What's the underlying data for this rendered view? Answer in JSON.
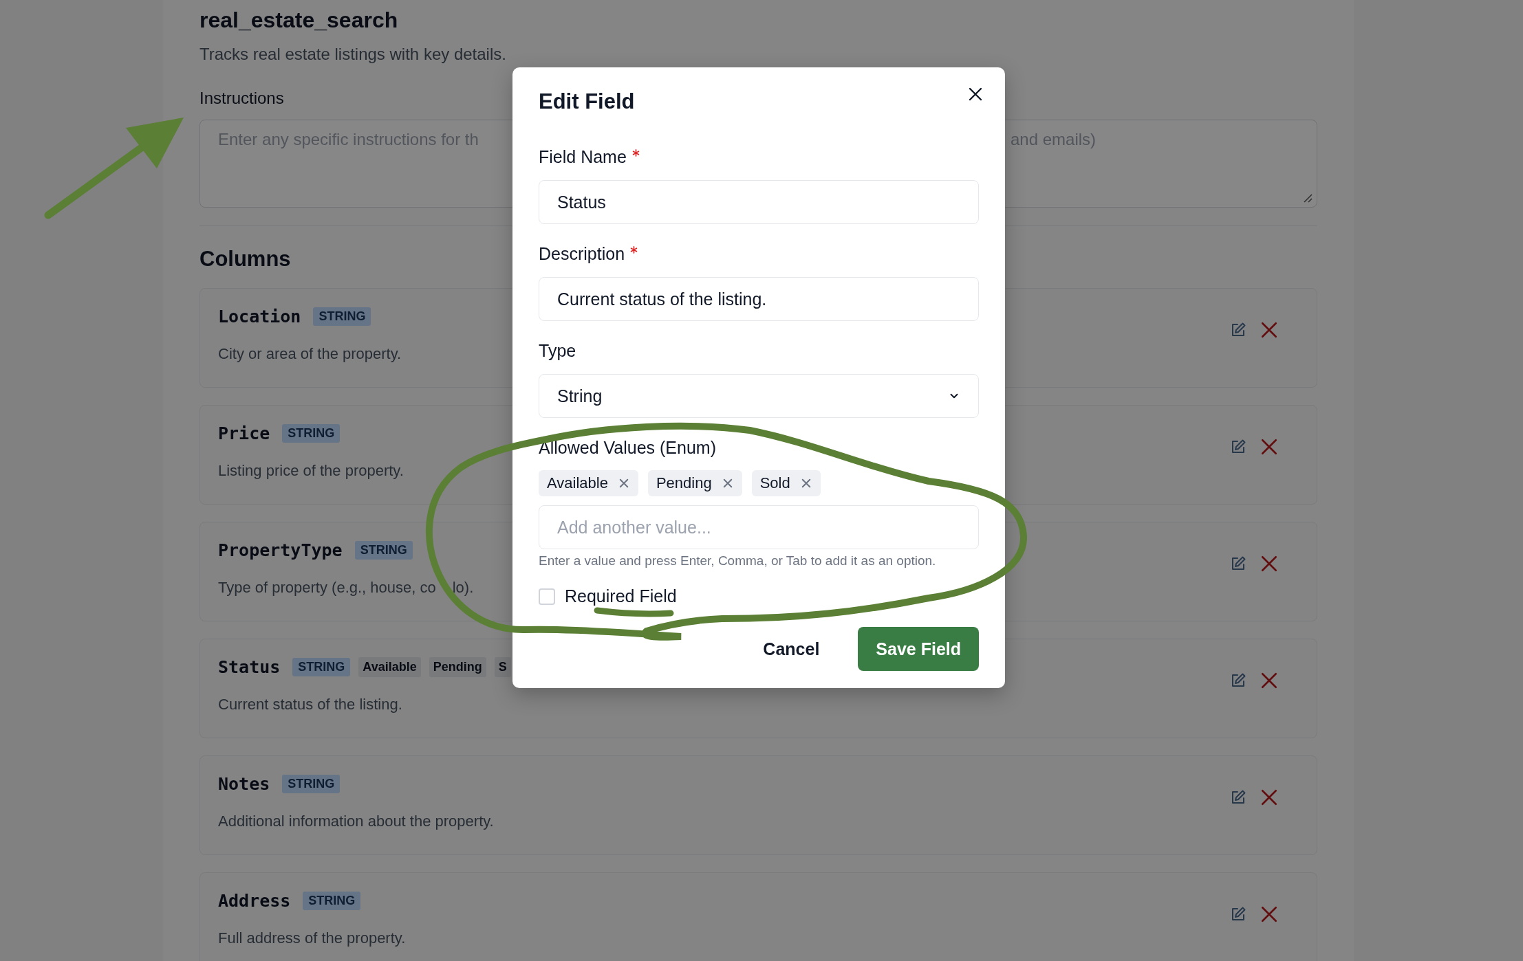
{
  "page": {
    "title": "real_estate_search",
    "description": "Tracks real estate listings with key details.",
    "instructions": {
      "label": "Instructions",
      "placeholder_start": "Enter any specific instructions for th",
      "placeholder_end": "and emails)"
    },
    "columns_heading": "Columns",
    "columns": [
      {
        "name": "Location",
        "type": "STRING",
        "description": "City or area of the property."
      },
      {
        "name": "Price",
        "type": "STRING",
        "description": "Listing price of the property."
      },
      {
        "name": "PropertyType",
        "type": "STRING",
        "description": "Type of property (e.g., house, co",
        "description_tail": "lo)."
      },
      {
        "name": "Status",
        "type": "STRING",
        "enum": [
          "Available",
          "Pending",
          "S"
        ],
        "description": "Current status of the listing."
      },
      {
        "name": "Notes",
        "type": "STRING",
        "description": "Additional information about the property."
      },
      {
        "name": "Address",
        "type": "STRING",
        "description": "Full address of the property."
      }
    ]
  },
  "dialog": {
    "title": "Edit Field",
    "fields": [
      {
        "kind": "text",
        "label": "Field Name",
        "required": true,
        "value": "Status"
      },
      {
        "kind": "text",
        "label": "Description",
        "required": true,
        "value": "Current status of the listing."
      },
      {
        "kind": "select",
        "label": "Type",
        "required": false,
        "value": "String"
      },
      {
        "kind": "enum",
        "label": "Allowed Values (Enum)",
        "required": false,
        "chips": [
          "Available",
          "Pending",
          "Sold"
        ],
        "placeholder": "Add another value...",
        "help": "Enter a value and press Enter, Comma, or Tab to add it as an option."
      }
    ],
    "checkbox": {
      "label": "Required Field",
      "checked": false
    },
    "buttons": [
      {
        "kind": "secondary",
        "label": "Cancel"
      },
      {
        "kind": "primary",
        "label": "Save Field"
      }
    ]
  }
}
